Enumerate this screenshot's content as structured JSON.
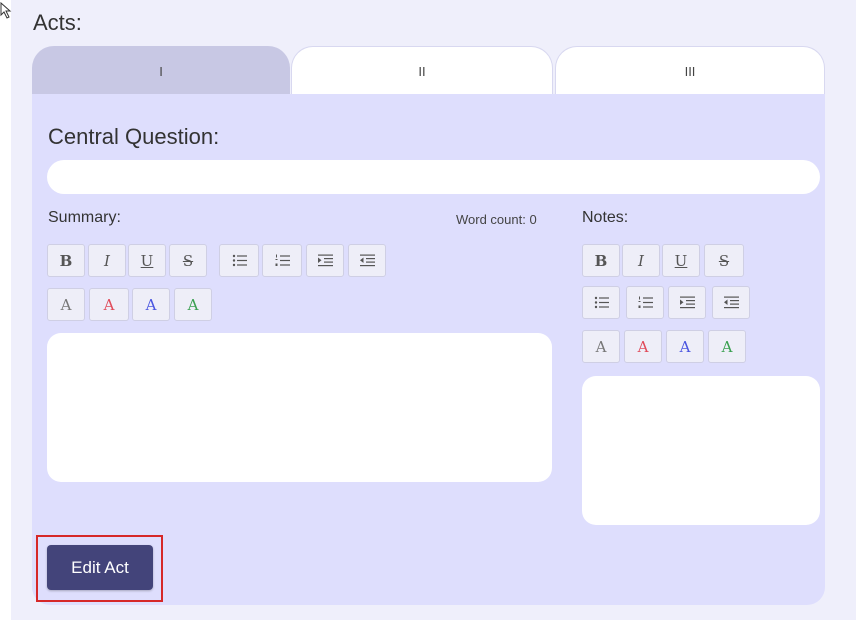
{
  "acts_label": "Acts:",
  "tabs": [
    {
      "label": "I",
      "active": true
    },
    {
      "label": "II",
      "active": false
    },
    {
      "label": "III",
      "active": false
    }
  ],
  "central_question": {
    "label": "Central Question:",
    "value": ""
  },
  "summary": {
    "label": "Summary:",
    "word_count": "Word count: 0",
    "text": ""
  },
  "notes": {
    "label": "Notes:",
    "text": ""
  },
  "toolbar": {
    "bold": "B",
    "italic": "I",
    "underline": "U",
    "strike": "S",
    "color_letter": "A",
    "font_colors": [
      "#777777",
      "#e04b5a",
      "#4a55e0",
      "#3aa050"
    ]
  },
  "edit_button": {
    "label": "Edit Act"
  },
  "colors": {
    "accent": "#43447a",
    "panel": "#dedefd",
    "active_tab": "#c8c8e4"
  }
}
